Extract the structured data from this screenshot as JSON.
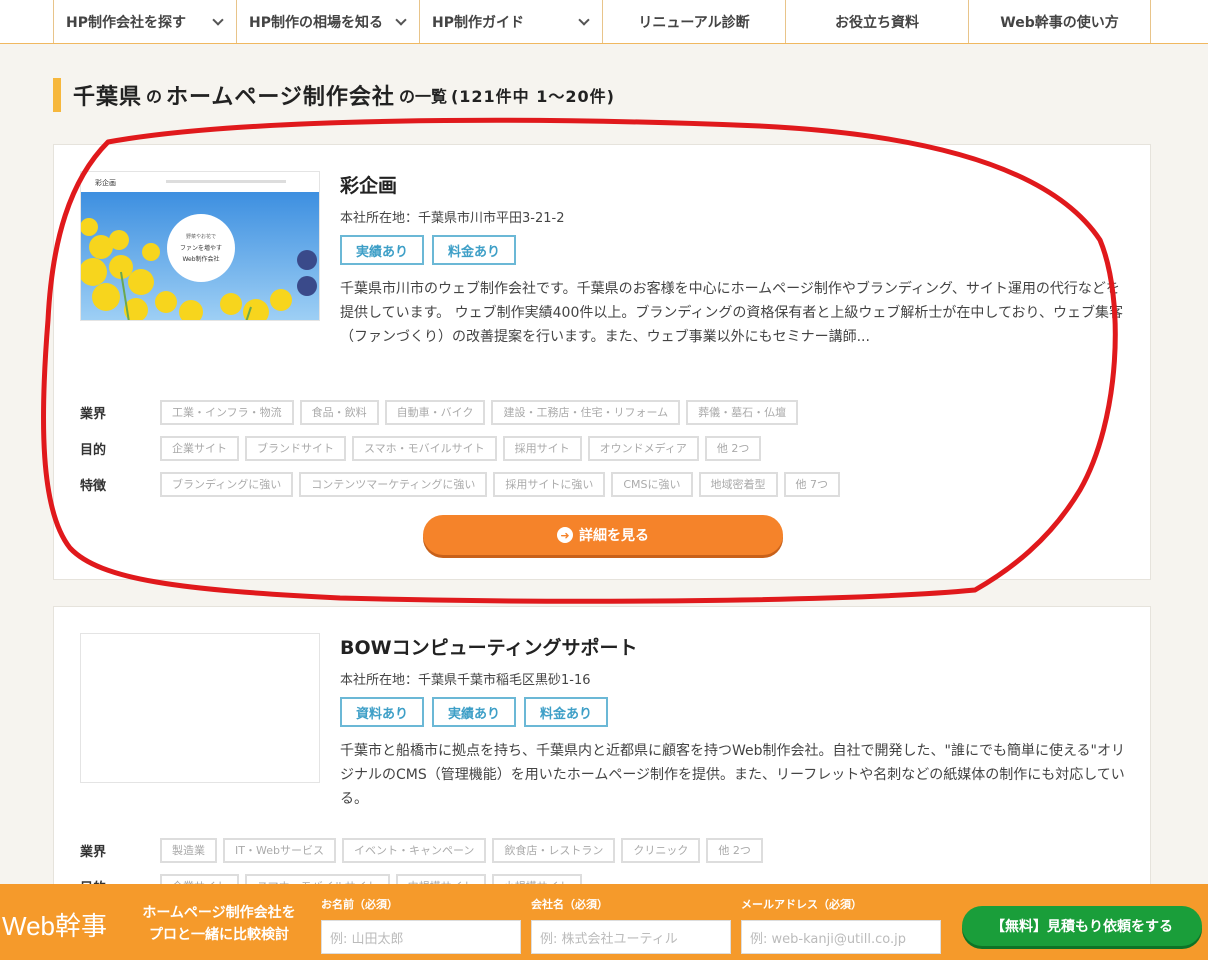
{
  "nav": {
    "items": [
      {
        "label": "HP制作会社を探す",
        "caret": true
      },
      {
        "label": "HP制作の相場を知る",
        "caret": true
      },
      {
        "label": "HP制作ガイド",
        "caret": true
      },
      {
        "label": "リニューアル診断",
        "caret": false
      },
      {
        "label": "お役立ち資料",
        "caret": false
      },
      {
        "label": "Web幹事の使い方",
        "caret": false
      }
    ]
  },
  "heading": {
    "pref": "千葉県",
    "no1": "の",
    "main": "ホームページ制作会社",
    "no2": "の一覧",
    "count": "(121件中 1〜20件)"
  },
  "companies": [
    {
      "name": "彩企画",
      "address": "本社所在地：千葉県市川市平田3-21-2",
      "badges": [
        "実績あり",
        "料金あり"
      ],
      "description": "千葉県市川市のウェブ制作会社です。千葉県のお客様を中心にホームページ制作やブランディング、サイト運用の代行などを提供しています。 ウェブ制作実績400件以上。ブランディングの資格保有者と上級ウェブ解析士が在中しており、ウェブ集客（ファンづくり）の改善提案を行います。また、ウェブ事業以外にもセミナー講師...",
      "thumb": {
        "logo": "彩企画",
        "circle_lines": [
          "野菜やお花で",
          "ファンを増やす",
          "Web制作会社"
        ]
      },
      "tags": {
        "industry": {
          "label": "業界",
          "items": [
            "工業・インフラ・物流",
            "食品・飲料",
            "自動車・バイク",
            "建設・工務店・住宅・リフォーム",
            "葬儀・墓石・仏壇"
          ]
        },
        "purpose": {
          "label": "目的",
          "items": [
            "企業サイト",
            "ブランドサイト",
            "スマホ・モバイルサイト",
            "採用サイト",
            "オウンドメディア",
            "他 2つ"
          ]
        },
        "feature": {
          "label": "特徴",
          "items": [
            "ブランディングに強い",
            "コンテンツマーケティングに強い",
            "採用サイトに強い",
            "CMSに強い",
            "地域密着型",
            "他 7つ"
          ]
        }
      },
      "detail_label": "詳細を見る"
    },
    {
      "name": "BOWコンピューティングサポート",
      "address": "本社所在地：千葉県千葉市稲毛区黒砂1-16",
      "badges": [
        "資料あり",
        "実績あり",
        "料金あり"
      ],
      "description": "千葉市と船橋市に拠点を持ち、千葉県内と近都県に顧客を持つWeb制作会社。自社で開発した、\"誰にでも簡単に使える\"オリジナルのCMS（管理機能）を用いたホームページ制作を提供。また、リーフレットや名刺などの紙媒体の制作にも対応している。",
      "tags": {
        "industry": {
          "label": "業界",
          "items": [
            "製造業",
            "IT・Webサービス",
            "イベント・キャンペーン",
            "飲食店・レストラン",
            "クリニック",
            "他 2つ"
          ]
        },
        "purpose": {
          "label": "目的",
          "items": [
            "企業サイト",
            "スマホ・モバイルサイト",
            "中規模サイト",
            "小規模サイト"
          ]
        }
      }
    }
  ],
  "footer": {
    "logo": "Web幹事",
    "tagline_1": "ホームページ制作会社を",
    "tagline_2": "プロと一緒に比較検討",
    "name_label": "お名前（必須）",
    "name_placeholder": "例: 山田太郎",
    "company_label": "会社名（必須）",
    "company_placeholder": "例: 株式会社ユーティル",
    "email_label": "メールアドレス（必須）",
    "email_placeholder": "例: web-kanji@utill.co.jp",
    "cta_label": "【無料】見積もり依頼をする"
  },
  "colors": {
    "accent": "#f5832a",
    "badge": "#3e9fc7",
    "footer": "#f59a2b",
    "cta": "#1a9e3a",
    "annotation": "#e0191c"
  }
}
